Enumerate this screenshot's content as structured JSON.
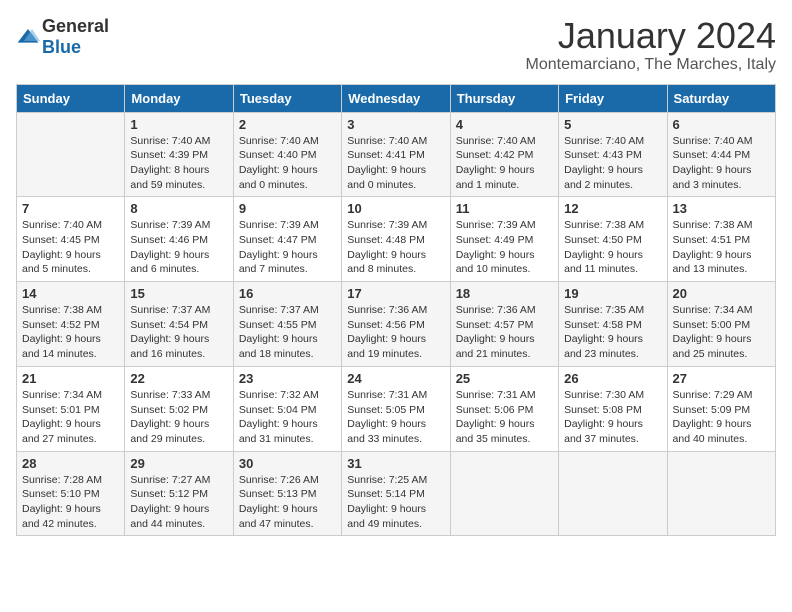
{
  "logo": {
    "text_general": "General",
    "text_blue": "Blue"
  },
  "title": "January 2024",
  "location": "Montemarciano, The Marches, Italy",
  "days_header": [
    "Sunday",
    "Monday",
    "Tuesday",
    "Wednesday",
    "Thursday",
    "Friday",
    "Saturday"
  ],
  "weeks": [
    [
      {
        "day": "",
        "info": ""
      },
      {
        "day": "1",
        "info": "Sunrise: 7:40 AM\nSunset: 4:39 PM\nDaylight: 8 hours\nand 59 minutes."
      },
      {
        "day": "2",
        "info": "Sunrise: 7:40 AM\nSunset: 4:40 PM\nDaylight: 9 hours\nand 0 minutes."
      },
      {
        "day": "3",
        "info": "Sunrise: 7:40 AM\nSunset: 4:41 PM\nDaylight: 9 hours\nand 0 minutes."
      },
      {
        "day": "4",
        "info": "Sunrise: 7:40 AM\nSunset: 4:42 PM\nDaylight: 9 hours\nand 1 minute."
      },
      {
        "day": "5",
        "info": "Sunrise: 7:40 AM\nSunset: 4:43 PM\nDaylight: 9 hours\nand 2 minutes."
      },
      {
        "day": "6",
        "info": "Sunrise: 7:40 AM\nSunset: 4:44 PM\nDaylight: 9 hours\nand 3 minutes."
      }
    ],
    [
      {
        "day": "7",
        "info": "Sunrise: 7:40 AM\nSunset: 4:45 PM\nDaylight: 9 hours\nand 5 minutes."
      },
      {
        "day": "8",
        "info": "Sunrise: 7:39 AM\nSunset: 4:46 PM\nDaylight: 9 hours\nand 6 minutes."
      },
      {
        "day": "9",
        "info": "Sunrise: 7:39 AM\nSunset: 4:47 PM\nDaylight: 9 hours\nand 7 minutes."
      },
      {
        "day": "10",
        "info": "Sunrise: 7:39 AM\nSunset: 4:48 PM\nDaylight: 9 hours\nand 8 minutes."
      },
      {
        "day": "11",
        "info": "Sunrise: 7:39 AM\nSunset: 4:49 PM\nDaylight: 9 hours\nand 10 minutes."
      },
      {
        "day": "12",
        "info": "Sunrise: 7:38 AM\nSunset: 4:50 PM\nDaylight: 9 hours\nand 11 minutes."
      },
      {
        "day": "13",
        "info": "Sunrise: 7:38 AM\nSunset: 4:51 PM\nDaylight: 9 hours\nand 13 minutes."
      }
    ],
    [
      {
        "day": "14",
        "info": "Sunrise: 7:38 AM\nSunset: 4:52 PM\nDaylight: 9 hours\nand 14 minutes."
      },
      {
        "day": "15",
        "info": "Sunrise: 7:37 AM\nSunset: 4:54 PM\nDaylight: 9 hours\nand 16 minutes."
      },
      {
        "day": "16",
        "info": "Sunrise: 7:37 AM\nSunset: 4:55 PM\nDaylight: 9 hours\nand 18 minutes."
      },
      {
        "day": "17",
        "info": "Sunrise: 7:36 AM\nSunset: 4:56 PM\nDaylight: 9 hours\nand 19 minutes."
      },
      {
        "day": "18",
        "info": "Sunrise: 7:36 AM\nSunset: 4:57 PM\nDaylight: 9 hours\nand 21 minutes."
      },
      {
        "day": "19",
        "info": "Sunrise: 7:35 AM\nSunset: 4:58 PM\nDaylight: 9 hours\nand 23 minutes."
      },
      {
        "day": "20",
        "info": "Sunrise: 7:34 AM\nSunset: 5:00 PM\nDaylight: 9 hours\nand 25 minutes."
      }
    ],
    [
      {
        "day": "21",
        "info": "Sunrise: 7:34 AM\nSunset: 5:01 PM\nDaylight: 9 hours\nand 27 minutes."
      },
      {
        "day": "22",
        "info": "Sunrise: 7:33 AM\nSunset: 5:02 PM\nDaylight: 9 hours\nand 29 minutes."
      },
      {
        "day": "23",
        "info": "Sunrise: 7:32 AM\nSunset: 5:04 PM\nDaylight: 9 hours\nand 31 minutes."
      },
      {
        "day": "24",
        "info": "Sunrise: 7:31 AM\nSunset: 5:05 PM\nDaylight: 9 hours\nand 33 minutes."
      },
      {
        "day": "25",
        "info": "Sunrise: 7:31 AM\nSunset: 5:06 PM\nDaylight: 9 hours\nand 35 minutes."
      },
      {
        "day": "26",
        "info": "Sunrise: 7:30 AM\nSunset: 5:08 PM\nDaylight: 9 hours\nand 37 minutes."
      },
      {
        "day": "27",
        "info": "Sunrise: 7:29 AM\nSunset: 5:09 PM\nDaylight: 9 hours\nand 40 minutes."
      }
    ],
    [
      {
        "day": "28",
        "info": "Sunrise: 7:28 AM\nSunset: 5:10 PM\nDaylight: 9 hours\nand 42 minutes."
      },
      {
        "day": "29",
        "info": "Sunrise: 7:27 AM\nSunset: 5:12 PM\nDaylight: 9 hours\nand 44 minutes."
      },
      {
        "day": "30",
        "info": "Sunrise: 7:26 AM\nSunset: 5:13 PM\nDaylight: 9 hours\nand 47 minutes."
      },
      {
        "day": "31",
        "info": "Sunrise: 7:25 AM\nSunset: 5:14 PM\nDaylight: 9 hours\nand 49 minutes."
      },
      {
        "day": "",
        "info": ""
      },
      {
        "day": "",
        "info": ""
      },
      {
        "day": "",
        "info": ""
      }
    ]
  ]
}
